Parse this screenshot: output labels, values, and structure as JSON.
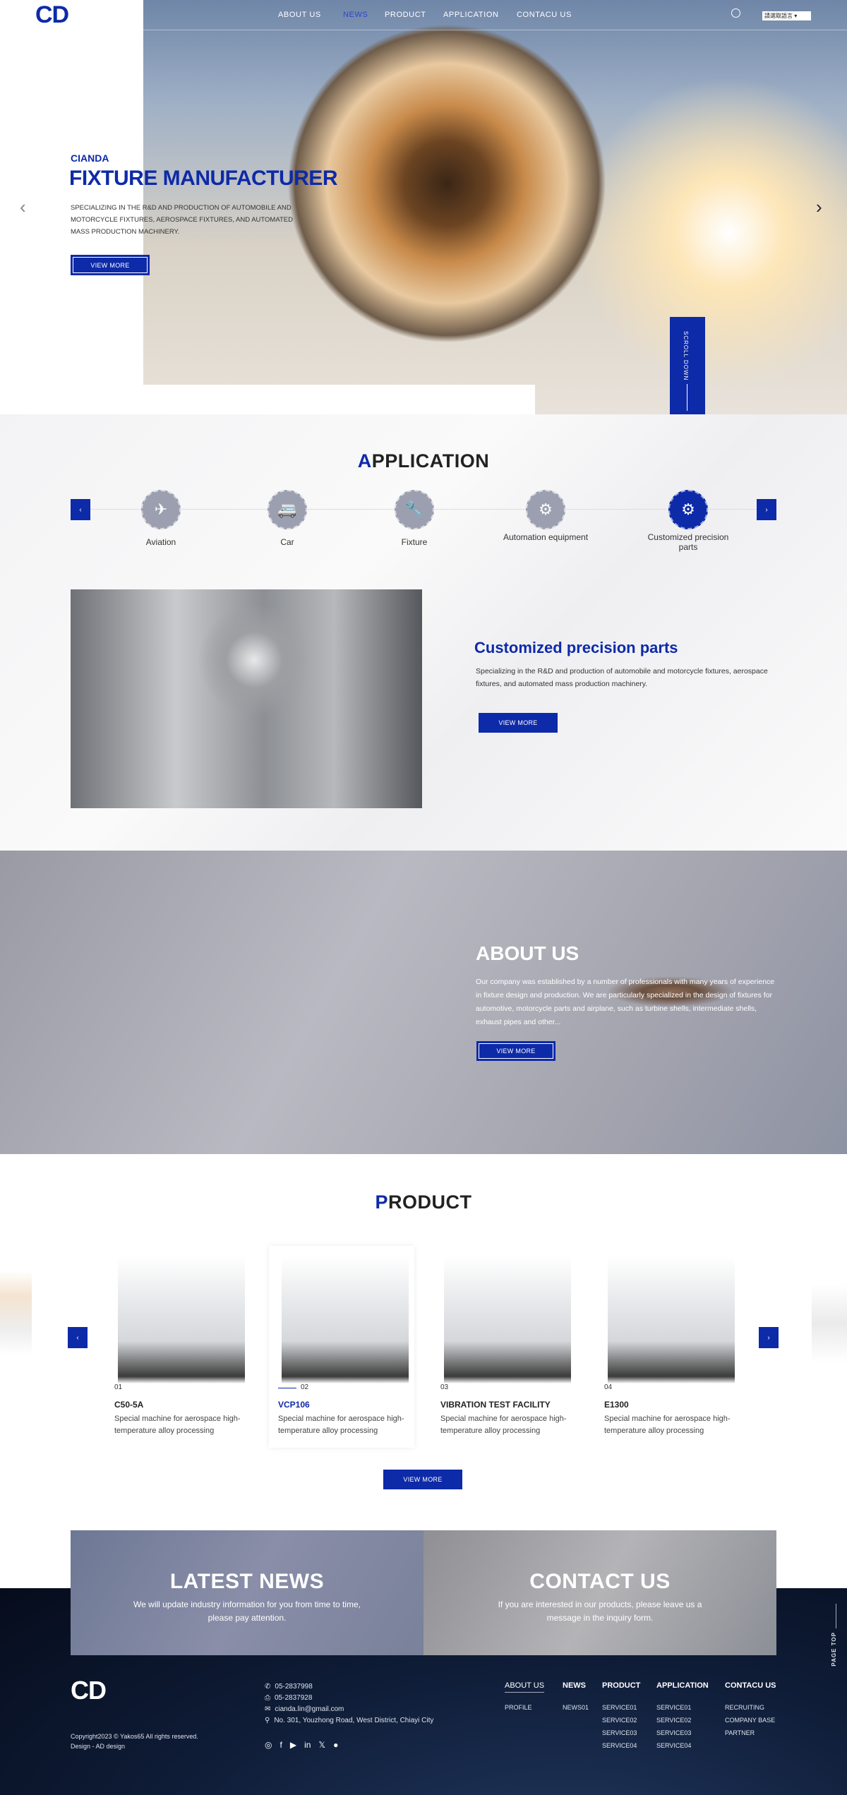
{
  "header": {
    "logo": "CD",
    "nav": [
      "ABOUT US",
      "NEWS",
      "PRODUCT",
      "APPLICATION",
      "CONTACU US"
    ],
    "active_nav": "NEWS",
    "language_select": "請選取語言",
    "search_icon": "search-icon"
  },
  "hero": {
    "eyebrow": "CIANDA",
    "title": "FIXTURE MANUFACTURER",
    "description": "SPECIALIZING IN THE R&D AND PRODUCTION OF AUTOMOBILE AND MOTORCYCLE FIXTURES, AEROSPACE FIXTURES, AND AUTOMATED MASS PRODUCTION MACHINERY.",
    "button": "VIEW MORE",
    "scroll": "SCROLL DOWN",
    "prev": "‹",
    "next": "›"
  },
  "application": {
    "title_first": "A",
    "title_rest": "PPLICATION",
    "items": [
      {
        "label": "Aviation",
        "icon": "✈"
      },
      {
        "label": "Car",
        "icon": "🚐"
      },
      {
        "label": "Fixture",
        "icon": "🔧"
      },
      {
        "label": "Automation equipment",
        "icon": "⚙"
      },
      {
        "label": "Customized precision parts",
        "icon": "⚙"
      }
    ],
    "active_index": 4,
    "detail": {
      "title": "Customized precision parts",
      "description": "Specializing in the R&D and production of automobile and motorcycle fixtures, aerospace fixtures, and automated mass production machinery.",
      "button": "VIEW MORE"
    },
    "prev": "‹",
    "next": "›"
  },
  "about": {
    "title": "ABOUT US",
    "description": "Our company was established by a number of professionals with many years of experience in fixture design and production. We are particularly specialized in the design of fixtures for automotive, motorcycle parts and airplane, such as turbine shells, intermediate shells, exhaust pipes and other...",
    "button": "VIEW MORE"
  },
  "product": {
    "title_first": "P",
    "title_rest": "RODUCT",
    "items": [
      {
        "num": "01",
        "name": "C50-5A",
        "desc": "Special machine for aerospace high-temperature alloy processing"
      },
      {
        "num": "02",
        "name": "VCP106",
        "desc": "Special machine for aerospace high-temperature alloy processing"
      },
      {
        "num": "03",
        "name": "VIBRATION TEST FACILITY",
        "desc": "Special machine for aerospace high-temperature alloy processing"
      },
      {
        "num": "04",
        "name": "E1300",
        "desc": "Special machine for aerospace high-temperature alloy processing"
      }
    ],
    "active_index": 1,
    "button": "VIEW MORE",
    "prev": "‹",
    "next": "›"
  },
  "banners": {
    "news": {
      "title": "LATEST NEWS",
      "desc": "We will update industry information for you from time to time, please pay attention."
    },
    "contact": {
      "title": "CONTACT US",
      "desc": "If you are interested in our products, please leave us a message in the inquiry form."
    }
  },
  "footer": {
    "logo": "CD",
    "copyright": "Copyright2023 © Yakos65 All rights reserved.",
    "design": "Design - AD design",
    "phone": "05-2837998",
    "fax": "05-2837928",
    "email": "cianda.lin@gmail.com",
    "address": "No. 301, Youzhong Road, West District, Chiayi City",
    "columns": [
      {
        "title": "ABOUT US",
        "items": [
          "PROFILE"
        ]
      },
      {
        "title": "NEWS",
        "items": [
          "NEWS01"
        ]
      },
      {
        "title": "PRODUCT",
        "items": [
          "SERVICE01",
          "SERVICE02",
          "SERVICE03",
          "SERVICE04"
        ]
      },
      {
        "title": "APPLICATION",
        "items": [
          "SERVICE01",
          "SERVICE02",
          "SERVICE03",
          "SERVICE04"
        ]
      },
      {
        "title": "CONTACU US",
        "items": [
          "RECRUITING",
          "COMPANY BASE",
          "PARTNER"
        ]
      }
    ],
    "social": [
      "instagram-icon",
      "facebook-icon",
      "youtube-icon",
      "linkedin-icon",
      "x-icon",
      "line-icon"
    ],
    "page_top": "PAGE TOP"
  },
  "colors": {
    "accent": "#0d2aa8",
    "footer_bg": "#0a1428"
  }
}
